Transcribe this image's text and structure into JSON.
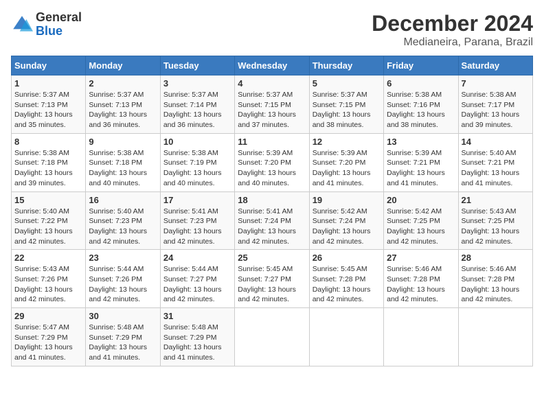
{
  "header": {
    "logo_general": "General",
    "logo_blue": "Blue",
    "title": "December 2024",
    "subtitle": "Medianeira, Parana, Brazil"
  },
  "days_of_week": [
    "Sunday",
    "Monday",
    "Tuesday",
    "Wednesday",
    "Thursday",
    "Friday",
    "Saturday"
  ],
  "weeks": [
    [
      {
        "day": "1",
        "sunrise": "5:37 AM",
        "sunset": "7:13 PM",
        "daylight": "Daylight: 13 hours and 35 minutes."
      },
      {
        "day": "2",
        "sunrise": "5:37 AM",
        "sunset": "7:13 PM",
        "daylight": "Daylight: 13 hours and 36 minutes."
      },
      {
        "day": "3",
        "sunrise": "5:37 AM",
        "sunset": "7:14 PM",
        "daylight": "Daylight: 13 hours and 36 minutes."
      },
      {
        "day": "4",
        "sunrise": "5:37 AM",
        "sunset": "7:15 PM",
        "daylight": "Daylight: 13 hours and 37 minutes."
      },
      {
        "day": "5",
        "sunrise": "5:37 AM",
        "sunset": "7:15 PM",
        "daylight": "Daylight: 13 hours and 38 minutes."
      },
      {
        "day": "6",
        "sunrise": "5:38 AM",
        "sunset": "7:16 PM",
        "daylight": "Daylight: 13 hours and 38 minutes."
      },
      {
        "day": "7",
        "sunrise": "5:38 AM",
        "sunset": "7:17 PM",
        "daylight": "Daylight: 13 hours and 39 minutes."
      }
    ],
    [
      {
        "day": "8",
        "sunrise": "5:38 AM",
        "sunset": "7:18 PM",
        "daylight": "Daylight: 13 hours and 39 minutes."
      },
      {
        "day": "9",
        "sunrise": "5:38 AM",
        "sunset": "7:18 PM",
        "daylight": "Daylight: 13 hours and 40 minutes."
      },
      {
        "day": "10",
        "sunrise": "5:38 AM",
        "sunset": "7:19 PM",
        "daylight": "Daylight: 13 hours and 40 minutes."
      },
      {
        "day": "11",
        "sunrise": "5:39 AM",
        "sunset": "7:20 PM",
        "daylight": "Daylight: 13 hours and 40 minutes."
      },
      {
        "day": "12",
        "sunrise": "5:39 AM",
        "sunset": "7:20 PM",
        "daylight": "Daylight: 13 hours and 41 minutes."
      },
      {
        "day": "13",
        "sunrise": "5:39 AM",
        "sunset": "7:21 PM",
        "daylight": "Daylight: 13 hours and 41 minutes."
      },
      {
        "day": "14",
        "sunrise": "5:40 AM",
        "sunset": "7:21 PM",
        "daylight": "Daylight: 13 hours and 41 minutes."
      }
    ],
    [
      {
        "day": "15",
        "sunrise": "5:40 AM",
        "sunset": "7:22 PM",
        "daylight": "Daylight: 13 hours and 42 minutes."
      },
      {
        "day": "16",
        "sunrise": "5:40 AM",
        "sunset": "7:23 PM",
        "daylight": "Daylight: 13 hours and 42 minutes."
      },
      {
        "day": "17",
        "sunrise": "5:41 AM",
        "sunset": "7:23 PM",
        "daylight": "Daylight: 13 hours and 42 minutes."
      },
      {
        "day": "18",
        "sunrise": "5:41 AM",
        "sunset": "7:24 PM",
        "daylight": "Daylight: 13 hours and 42 minutes."
      },
      {
        "day": "19",
        "sunrise": "5:42 AM",
        "sunset": "7:24 PM",
        "daylight": "Daylight: 13 hours and 42 minutes."
      },
      {
        "day": "20",
        "sunrise": "5:42 AM",
        "sunset": "7:25 PM",
        "daylight": "Daylight: 13 hours and 42 minutes."
      },
      {
        "day": "21",
        "sunrise": "5:43 AM",
        "sunset": "7:25 PM",
        "daylight": "Daylight: 13 hours and 42 minutes."
      }
    ],
    [
      {
        "day": "22",
        "sunrise": "5:43 AM",
        "sunset": "7:26 PM",
        "daylight": "Daylight: 13 hours and 42 minutes."
      },
      {
        "day": "23",
        "sunrise": "5:44 AM",
        "sunset": "7:26 PM",
        "daylight": "Daylight: 13 hours and 42 minutes."
      },
      {
        "day": "24",
        "sunrise": "5:44 AM",
        "sunset": "7:27 PM",
        "daylight": "Daylight: 13 hours and 42 minutes."
      },
      {
        "day": "25",
        "sunrise": "5:45 AM",
        "sunset": "7:27 PM",
        "daylight": "Daylight: 13 hours and 42 minutes."
      },
      {
        "day": "26",
        "sunrise": "5:45 AM",
        "sunset": "7:28 PM",
        "daylight": "Daylight: 13 hours and 42 minutes."
      },
      {
        "day": "27",
        "sunrise": "5:46 AM",
        "sunset": "7:28 PM",
        "daylight": "Daylight: 13 hours and 42 minutes."
      },
      {
        "day": "28",
        "sunrise": "5:46 AM",
        "sunset": "7:28 PM",
        "daylight": "Daylight: 13 hours and 42 minutes."
      }
    ],
    [
      {
        "day": "29",
        "sunrise": "5:47 AM",
        "sunset": "7:29 PM",
        "daylight": "Daylight: 13 hours and 41 minutes."
      },
      {
        "day": "30",
        "sunrise": "5:48 AM",
        "sunset": "7:29 PM",
        "daylight": "Daylight: 13 hours and 41 minutes."
      },
      {
        "day": "31",
        "sunrise": "5:48 AM",
        "sunset": "7:29 PM",
        "daylight": "Daylight: 13 hours and 41 minutes."
      },
      null,
      null,
      null,
      null
    ]
  ]
}
